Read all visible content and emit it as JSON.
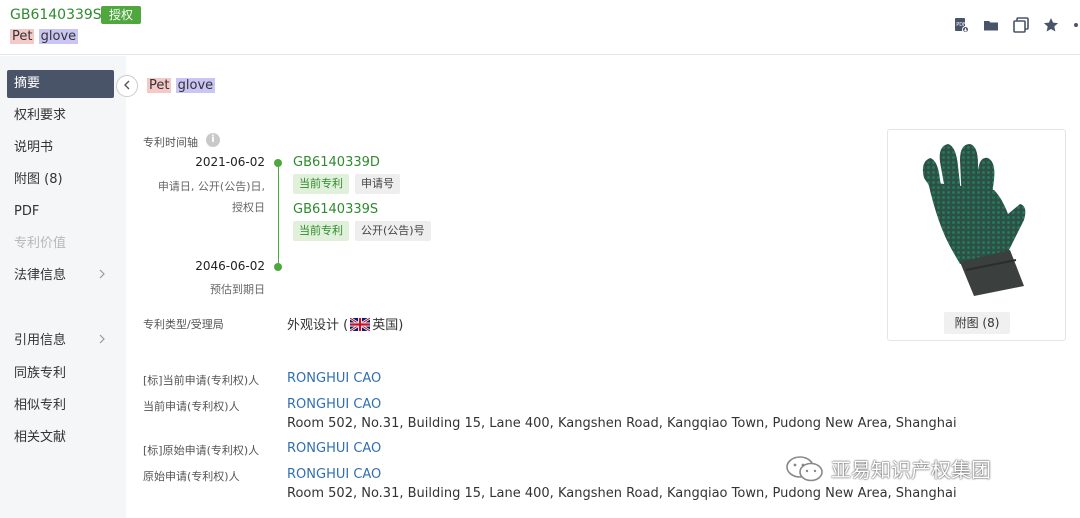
{
  "header": {
    "pub_no": "GB6140339S",
    "badge": "授权",
    "title_part1": "Pet",
    "title_part2": "glove"
  },
  "sidebar": {
    "items": [
      {
        "label": "摘要"
      },
      {
        "label": "权利要求"
      },
      {
        "label": "说明书"
      },
      {
        "label": "附图 (8)"
      },
      {
        "label": "PDF"
      },
      {
        "label": "专利价值"
      },
      {
        "label": "法律信息"
      },
      {
        "label": "引用信息"
      },
      {
        "label": "同族专利"
      },
      {
        "label": "相似专利"
      },
      {
        "label": "相关文献"
      }
    ]
  },
  "main": {
    "title_part1": "Pet",
    "title_part2": "glove",
    "timeline_label": "专利时间轴",
    "timeline": {
      "event1": {
        "date": "2021-06-02",
        "sub1": "申请日, 公开(公告)日,",
        "sub2": "授权日",
        "pub1": "GB6140339D",
        "tag1a": "当前专利",
        "tag1b": "申请号",
        "pub2": "GB6140339S",
        "tag2a": "当前专利",
        "tag2b": "公开(公告)号"
      },
      "event2": {
        "date": "2046-06-02",
        "sub": "预估到期日"
      }
    },
    "type_label": "专利类型/受理局",
    "type_value": "外观设计 (",
    "country": "英国)",
    "fields": {
      "std_current_applicant_label": "[标]当前申请(专利权)人",
      "std_current_applicant": "RONGHUI CAO",
      "current_applicant_label": "当前申请(专利权)人",
      "current_applicant": "RONGHUI CAO",
      "current_address": "Room 502, No.31, Building 15, Lane 400, Kangshen Road, Kangqiao Town, Pudong New Area, Shanghai",
      "std_original_applicant_label": "[标]原始申请(专利权)人",
      "std_original_applicant": "RONGHUI CAO",
      "original_applicant_label": "原始申请(专利权)人",
      "original_applicant": "RONGHUI CAO",
      "original_address": "Room 502, No.31, Building 15, Lane 400, Kangshen Road, Kangqiao Town, Pudong New Area, Shanghai"
    },
    "figure_button": "附图 (8)"
  },
  "watermark": {
    "text": "亚易知识产权集团"
  },
  "colors": {
    "accent_green": "#4fa83d",
    "link_blue": "#2f6fb5",
    "sidebar_active": "#4a5468"
  }
}
